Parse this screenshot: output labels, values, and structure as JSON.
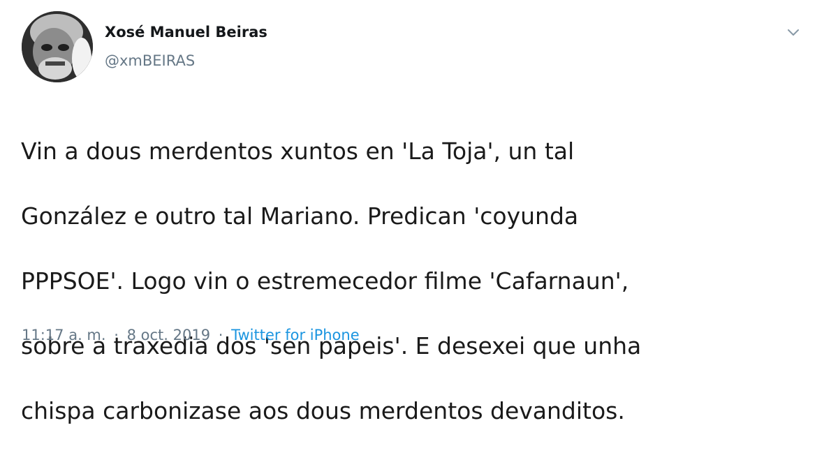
{
  "author": {
    "display_name": "Xosé Manuel Beiras",
    "handle": "@xmBEIRAS",
    "avatar_icon": "profile-photo-avatar"
  },
  "tweet": {
    "text_lines": [
      "Vin a dous merdentos xuntos en 'La Toja', un tal",
      "González e outro tal Mariano. Predican 'coyunda",
      "PPPSOE'. Logo vin o estremecedor filme 'Cafarnaun',",
      "sobre a traxedia dos 'sen papeis'. E desexei que unha",
      "chispa carbonizase aos dous merdentos devanditos."
    ]
  },
  "meta": {
    "time": "11:17 a. m.",
    "separator": "·",
    "date": "8 oct. 2019",
    "source": "Twitter for iPhone"
  },
  "menu": {
    "icon": "chevron-down-icon"
  },
  "colors": {
    "text": "#14171a",
    "secondary": "#657786",
    "link": "#1b95e0",
    "background": "#ffffff"
  }
}
